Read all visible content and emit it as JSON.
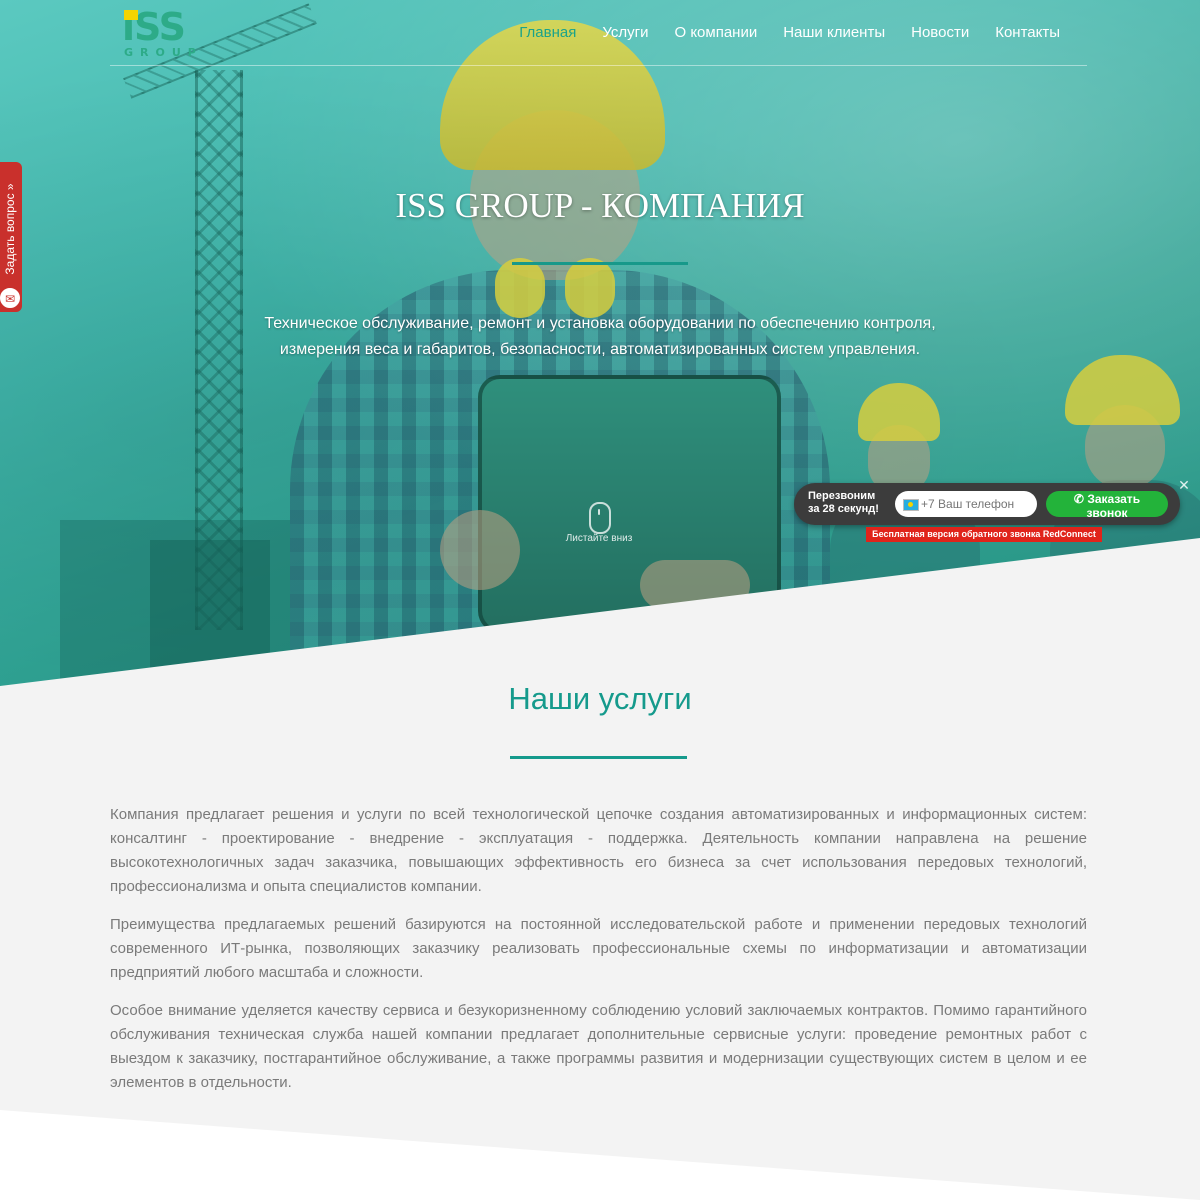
{
  "colors": {
    "accent": "#159a8c",
    "nav_active": "#1ba38a",
    "side_tab": "#c9302c",
    "callback_button": "#23b33a",
    "promo": "#e0241b"
  },
  "header": {
    "logo_main": "iSS",
    "logo_sub": "GROUP",
    "nav": [
      {
        "label": "Главная",
        "active": true
      },
      {
        "label": "Услуги",
        "active": false
      },
      {
        "label": "О компании",
        "active": false
      },
      {
        "label": "Наши клиенты",
        "active": false
      },
      {
        "label": "Новости",
        "active": false
      },
      {
        "label": "Контакты",
        "active": false
      }
    ]
  },
  "hero": {
    "title": "ISS GROUP - КОМПАНИЯ",
    "subtitle_line1": "Техническое обслуживание, ремонт и установка оборудовании по обеспечению контроля,",
    "subtitle_line2": "измерения веса и габаритов, безопасности, автоматизированных систем управления.",
    "scroll_label": "Листайте вниз"
  },
  "side_tab": {
    "label": "Задать вопрос »",
    "icon": "envelope-icon"
  },
  "callback": {
    "label_line1": "Перезвоним",
    "label_line2": "за 28 секунд!",
    "phone_placeholder": "+7 Ваш телефон",
    "button_label": "Заказать звонок",
    "button_icon": "phone-icon",
    "close_icon": "close-icon",
    "promo": "Бесплатная версия обратного звонка RedConnect"
  },
  "services": {
    "title": "Наши услуги",
    "paragraphs": [
      "Компания предлагает решения и услуги по всей технологической цепочке создания автоматизированных и информационных систем: консалтинг - проектирование - внедрение - эксплуатация - поддержка. Деятельность компании направлена на решение высокотехнологичных задач заказчика, повышающих эффективность его бизнеса за счет использования передовых технологий, профессионализма и опыта специалистов компании.",
      "Преимущества предлагаемых решений базируются на постоянной исследовательской работе и применении передовых технологий современного ИТ-рынка, позволяющих заказчику реализовать профессиональные схемы по информатизации и автоматизации предприятий любого масштаба и сложности.",
      "Особое внимание уделяется качеству сервиса и безукоризненному соблюдению условий заключаемых контрактов. Помимо гарантийного обслуживания техническая служба нашей компании предлагает дополнительные сервисные услуги: проведение ремонтных работ с выездом к заказчику, постгарантийное обслуживание, а также программы развития и модернизации существующих систем в целом и ее элементов в отдельности."
    ]
  }
}
